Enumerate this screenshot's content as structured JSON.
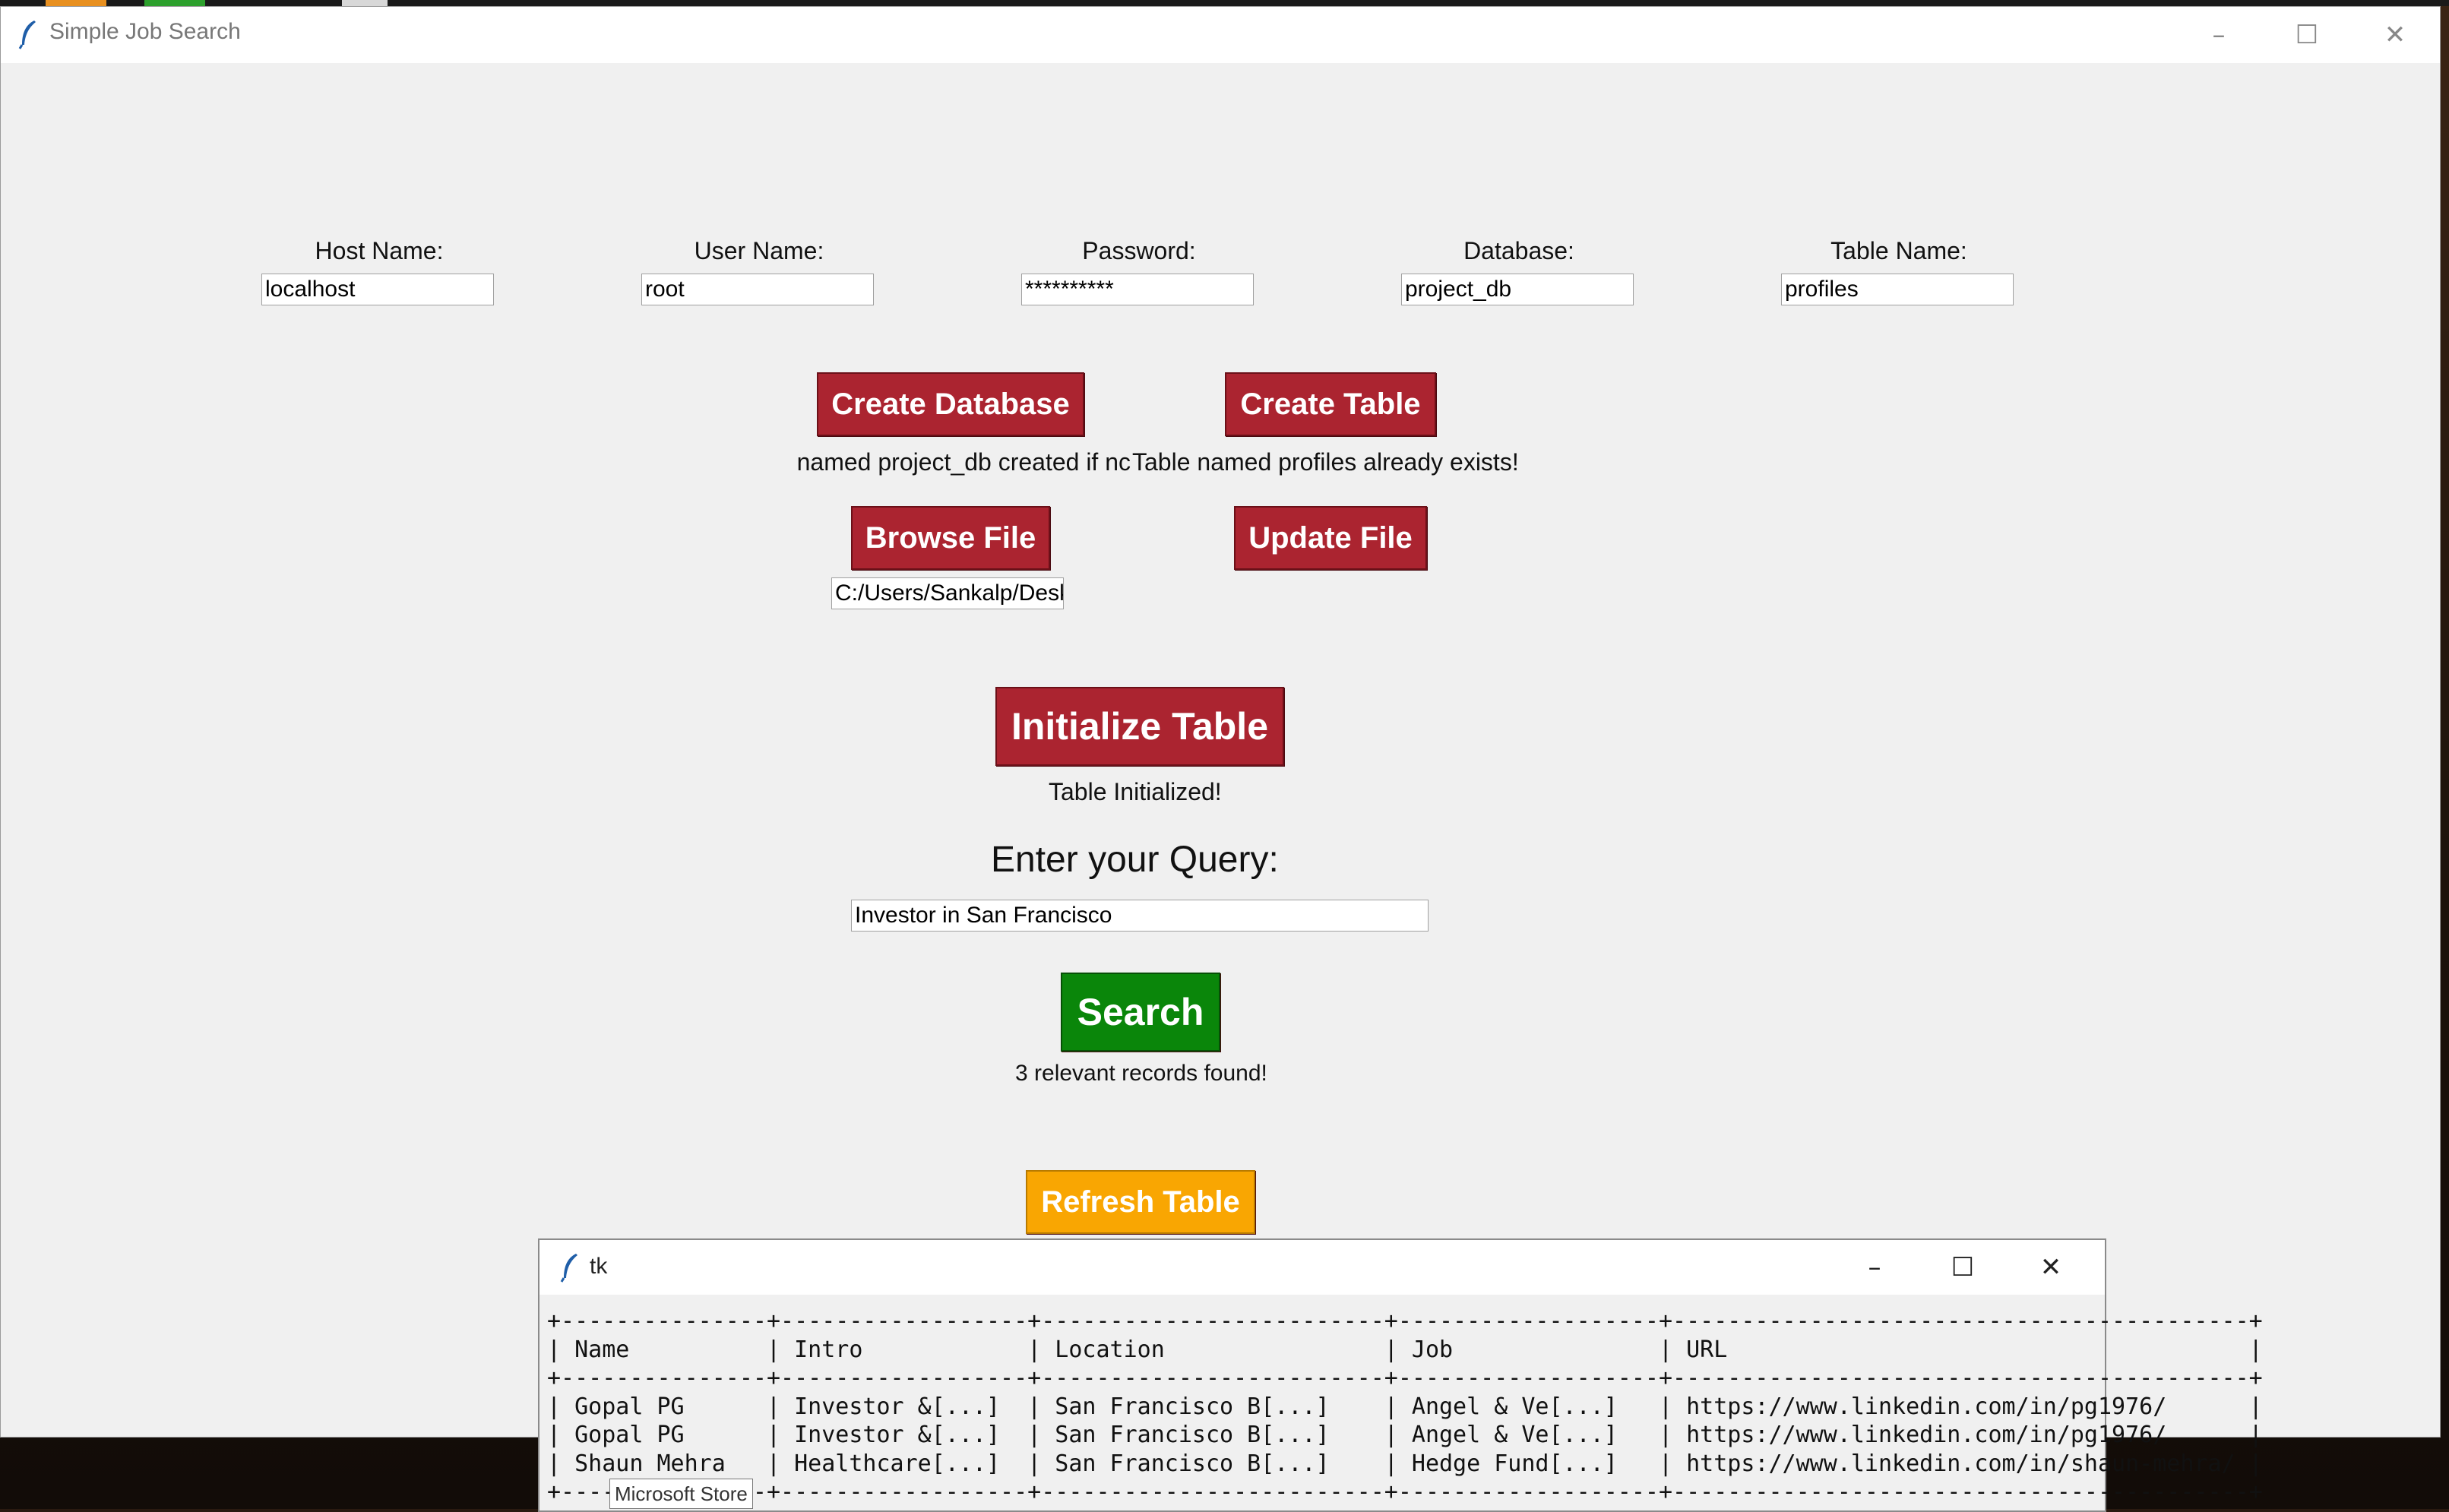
{
  "window": {
    "title": "Simple Job Search",
    "minimize": "–",
    "maximize": "☐",
    "close": "✕"
  },
  "fields": [
    {
      "label": "Host Name:",
      "value": "localhost"
    },
    {
      "label": "User Name:",
      "value": "root"
    },
    {
      "label": "Password:",
      "value": "**********"
    },
    {
      "label": "Database:",
      "value": "project_db"
    },
    {
      "label": "Table Name:",
      "value": "profiles"
    }
  ],
  "buttons": {
    "create_database": "Create Database",
    "create_table": "Create Table",
    "browse_file": "Browse File",
    "update_file": "Update File",
    "initialize_table": "Initialize Table",
    "search": "Search",
    "refresh_table": "Refresh Table"
  },
  "status": {
    "database": "Database named project_db created if nc",
    "table": "Table named profiles already exists!",
    "initialize": "Table Initialized!",
    "search_result": "3 relevant records found!"
  },
  "file_path": "C:/Users/Sankalp/Desk",
  "query": {
    "label": "Enter your Query:",
    "value": "Investor in San Francisco"
  },
  "colors": {
    "red_button": "#ab2430",
    "search_button": "#0a860a",
    "refresh_button": "#f9a602"
  },
  "results_window": {
    "title": "tk",
    "minimize": "–",
    "maximize": "☐",
    "close": "✕",
    "table_text": "+---------------+------------------+-------------------------+-------------------+------------------------------------------+\n| Name          | Intro            | Location                | Job               | URL                                      |\n+---------------+------------------+-------------------------+-------------------+------------------------------------------+\n| Gopal PG      | Investor &[...]  | San Francisco B[...]    | Angel & Ve[...]   | https://www.linkedin.com/in/pg1976/      |\n| Gopal PG      | Investor &[...]  | San Francisco B[...]    | Angel & Ve[...]   | https://www.linkedin.com/in/pg1976/      |\n| Shaun Mehra   | Healthcare[...]  | San Francisco B[...]    | Hedge Fund[...]   | https://www.linkedin.com/in/shaun-mehra/ |\n+---------------+------------------+-------------------------+-------------------+------------------------------------------+"
  },
  "tooltip": "Microsoft Store"
}
